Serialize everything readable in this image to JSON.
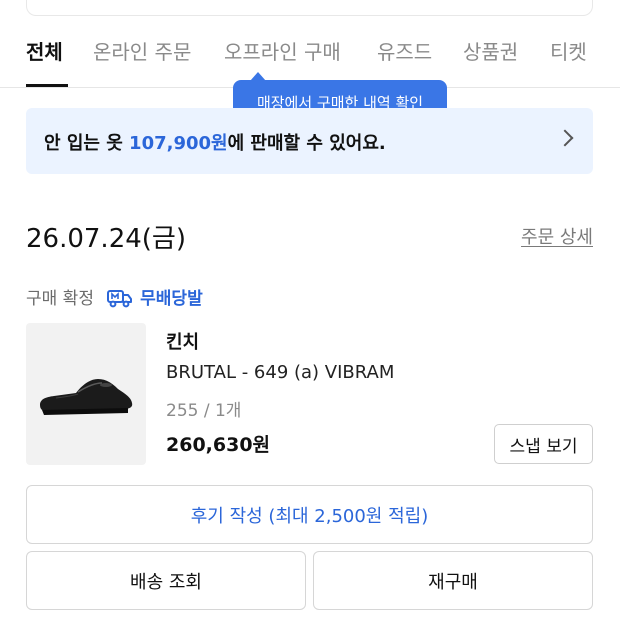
{
  "tabs": [
    {
      "label": "전체",
      "active": true
    },
    {
      "label": "온라인 주문",
      "active": false
    },
    {
      "label": "오프라인 구매",
      "active": false
    },
    {
      "label": "유즈드",
      "active": false
    },
    {
      "label": "상품권",
      "active": false
    },
    {
      "label": "티켓",
      "active": false
    }
  ],
  "tooltip": {
    "text": "매장에서 구매한 내역 확인"
  },
  "banner": {
    "prefix": "안 입는 옷 ",
    "amount": "107,900원",
    "suffix": "에 판매할 수 있어요.",
    "icon": "chevron-right-icon"
  },
  "order": {
    "date": "26.07.24(금)",
    "detail_link": "주문 상세",
    "status": "구매 확정",
    "delivery_label": "무배당발",
    "delivery_icon": "truck-icon",
    "product": {
      "brand": "킨치",
      "name": "BRUTAL - 649 (a) VIBRAM",
      "option": "255 / 1개",
      "price": "260,630원",
      "image": "black-derby-shoe"
    },
    "snap_button": "스냅 보기",
    "review_button": "후기 작성 (최대 2,500원 적립)",
    "shipping_button": "배송 조회",
    "rebuy_button": "재구매"
  },
  "colors": {
    "accent": "#2b66d9",
    "tooltip_bg": "#3a76e6",
    "banner_bg": "#ebf3ff"
  }
}
